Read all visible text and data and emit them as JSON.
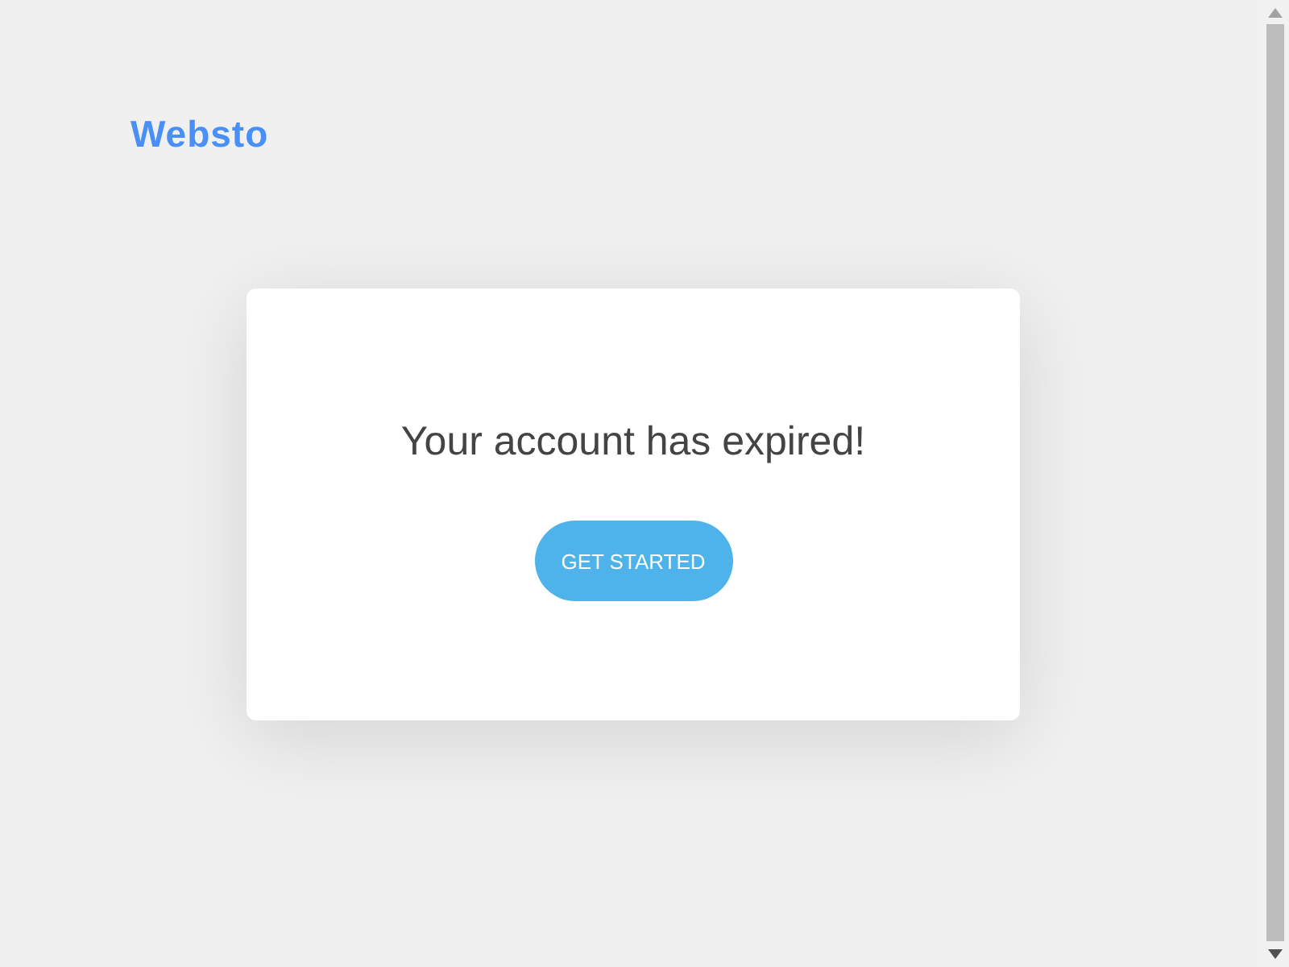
{
  "logo": "Websto",
  "card": {
    "title": "Your account has expired!",
    "button": "GET STARTED"
  }
}
